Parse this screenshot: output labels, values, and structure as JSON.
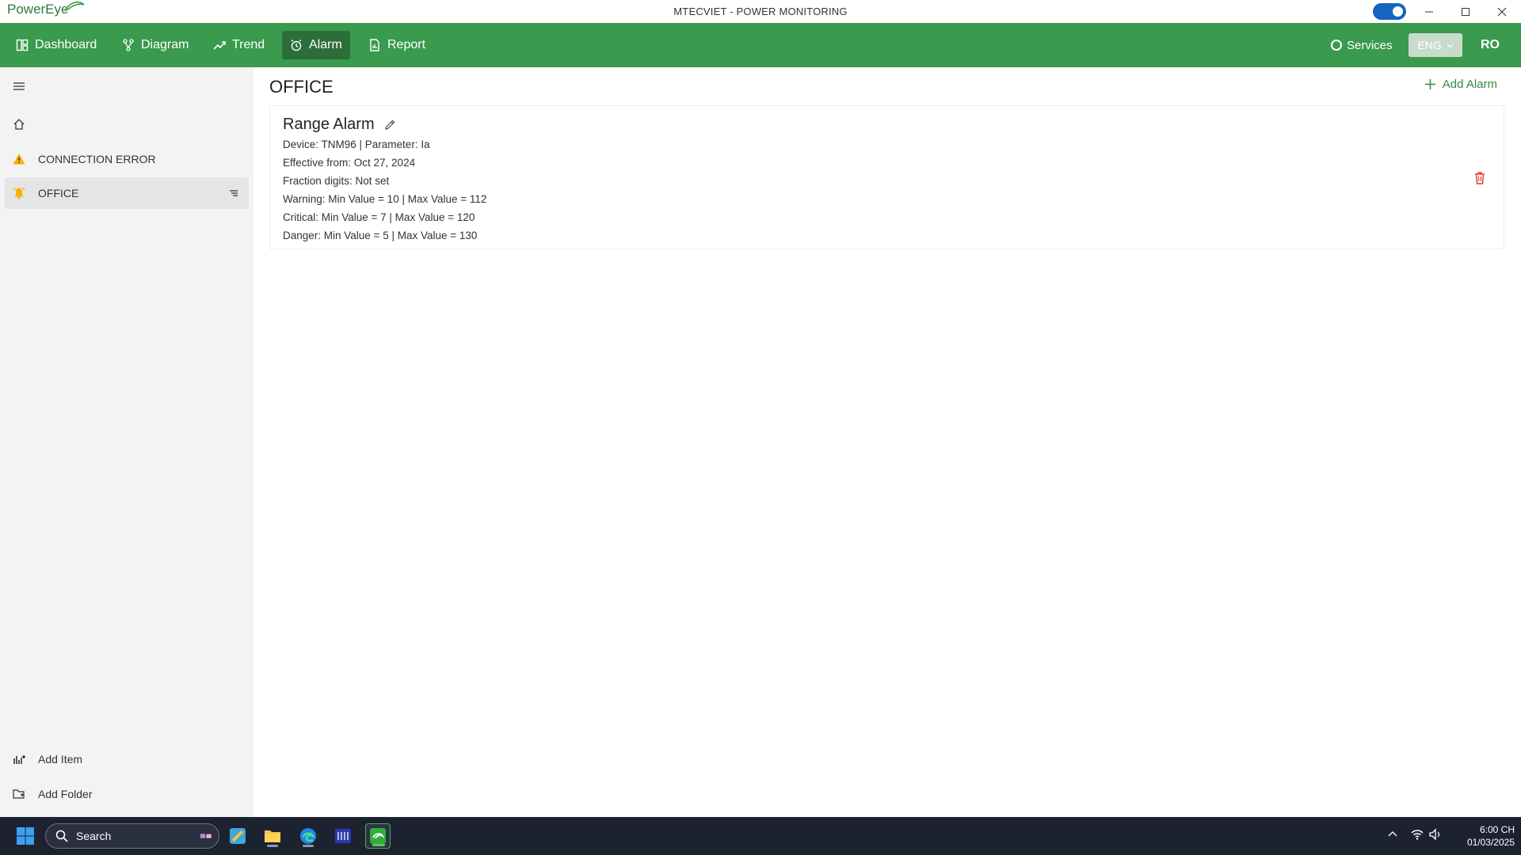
{
  "app": {
    "logo_text": "PowerEye",
    "window_title": "MTECVIET - POWER MONITORING"
  },
  "nav": {
    "items": [
      {
        "label": "Dashboard",
        "icon": "dashboard-icon"
      },
      {
        "label": "Diagram",
        "icon": "diagram-icon"
      },
      {
        "label": "Trend",
        "icon": "trend-icon"
      },
      {
        "label": "Alarm",
        "icon": "alarm-clock-icon",
        "active": true
      },
      {
        "label": "Report",
        "icon": "report-icon"
      }
    ],
    "services_label": "Services",
    "language": "ENG",
    "user_initials": "RO"
  },
  "sidebar": {
    "items": [
      {
        "label": "",
        "icon": "home-icon"
      },
      {
        "label": "CONNECTION ERROR",
        "icon": "warning-icon"
      },
      {
        "label": "OFFICE",
        "icon": "bell-icon",
        "selected": true
      }
    ],
    "bottom": [
      {
        "label": "Add Item",
        "icon": "add-item-icon"
      },
      {
        "label": "Add Folder",
        "icon": "add-folder-icon"
      }
    ]
  },
  "main": {
    "title": "OFFICE",
    "add_alarm_label": "Add Alarm",
    "alarm": {
      "title": "Range Alarm",
      "lines": [
        "Device: TNM96 | Parameter: Ia",
        "Effective from: Oct 27, 2024",
        "Fraction digits: Not set",
        "Warning: Min Value = 10 | Max Value = 112",
        "Critical: Min Value = 7 | Max Value = 120",
        "Danger: Min Value = 5 | Max Value = 130"
      ]
    }
  },
  "taskbar": {
    "search_label": "Search",
    "time": "6:00 CH",
    "date": "01/03/2025"
  },
  "colors": {
    "brand_green": "#3a9a4e",
    "active_tab": "#2b6e39",
    "danger_red": "#e53935",
    "toggle_blue": "#1565c0"
  }
}
